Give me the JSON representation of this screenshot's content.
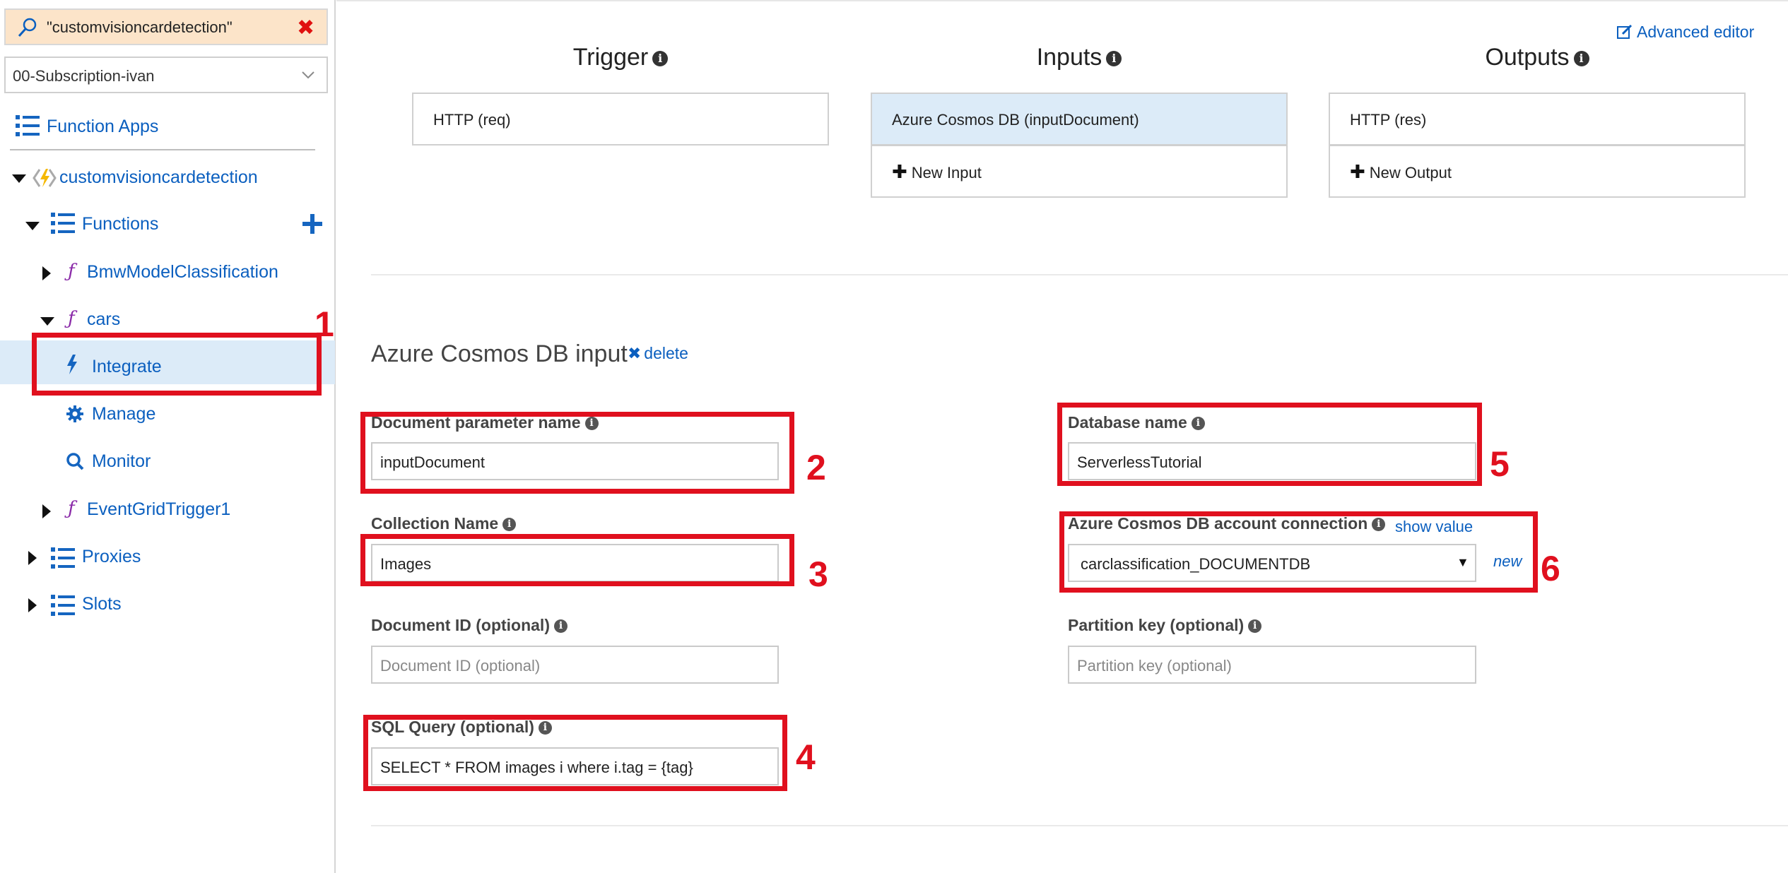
{
  "search": {
    "value": "\"customvisioncardetection\""
  },
  "subscription": {
    "selected": "00-Subscription-ivan"
  },
  "nav": {
    "function_apps": "Function Apps",
    "app_name": "customvisioncardetection",
    "functions": "Functions",
    "items": [
      {
        "label": "BmwModelClassification"
      },
      {
        "label": "cars"
      },
      {
        "label": "EventGridTrigger1"
      }
    ],
    "cars_children": [
      {
        "label": "Integrate"
      },
      {
        "label": "Manage"
      },
      {
        "label": "Monitor"
      }
    ],
    "proxies": "Proxies",
    "slots": "Slots"
  },
  "header": {
    "advanced_editor": "Advanced editor"
  },
  "columns": {
    "trigger": {
      "title": "Trigger",
      "items": [
        "HTTP (req)"
      ]
    },
    "inputs": {
      "title": "Inputs",
      "items": [
        "Azure Cosmos DB (inputDocument)"
      ],
      "new_label": "New Input"
    },
    "outputs": {
      "title": "Outputs",
      "items": [
        "HTTP (res)"
      ],
      "new_label": "New Output"
    }
  },
  "section": {
    "title": "Azure Cosmos DB input",
    "delete_label": "delete"
  },
  "form": {
    "doc_param": {
      "label": "Document parameter name",
      "value": "inputDocument"
    },
    "collection": {
      "label": "Collection Name",
      "value": "Images"
    },
    "doc_id": {
      "label": "Document ID (optional)",
      "placeholder": "Document ID (optional)"
    },
    "sql": {
      "label": "SQL Query (optional)",
      "value": "SELECT * FROM images i where i.tag = {tag}"
    },
    "db_name": {
      "label": "Database name",
      "value": "ServerlessTutorial"
    },
    "connection": {
      "label": "Azure Cosmos DB account connection",
      "show_value": "show value",
      "value": "carclassification_DOCUMENTDB",
      "new_label": "new"
    },
    "partition": {
      "label": "Partition key (optional)",
      "placeholder": "Partition key (optional)"
    }
  },
  "annotations": [
    "1",
    "2",
    "3",
    "4",
    "5",
    "6"
  ],
  "colors": {
    "accent": "#0b5fbf",
    "annotation_red": "#e0101e",
    "selected_bg": "#dcebf8",
    "search_bg": "#fce4c9"
  }
}
